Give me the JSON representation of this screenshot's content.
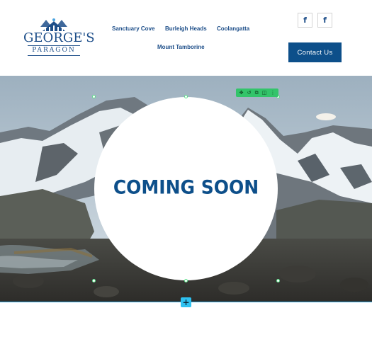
{
  "logo": {
    "line1": "GEORGE'S",
    "line2": "PARAGON"
  },
  "nav": {
    "items": [
      {
        "label": "Sanctuary Cove"
      },
      {
        "label": "Burleigh Heads"
      },
      {
        "label": "Coolangatta"
      },
      {
        "label": "Mount Tamborine"
      }
    ]
  },
  "social": {
    "facebook_1": "f",
    "facebook_2": "f"
  },
  "contact_button": {
    "label": "Contact Us"
  },
  "hero": {
    "heading": "COMING SOON"
  },
  "editor_toolbar": {
    "icons": [
      "move-icon",
      "undo-icon",
      "copy-icon",
      "duplicate-icon",
      "more-icon"
    ],
    "glyphs": [
      "✥",
      "↺",
      "⧉",
      "◫",
      "⋮"
    ]
  },
  "add_section": {
    "label": "+"
  },
  "colors": {
    "brand": "#0d4f8a",
    "accent": "#2ec1f0",
    "editor_green": "#33c46a"
  }
}
